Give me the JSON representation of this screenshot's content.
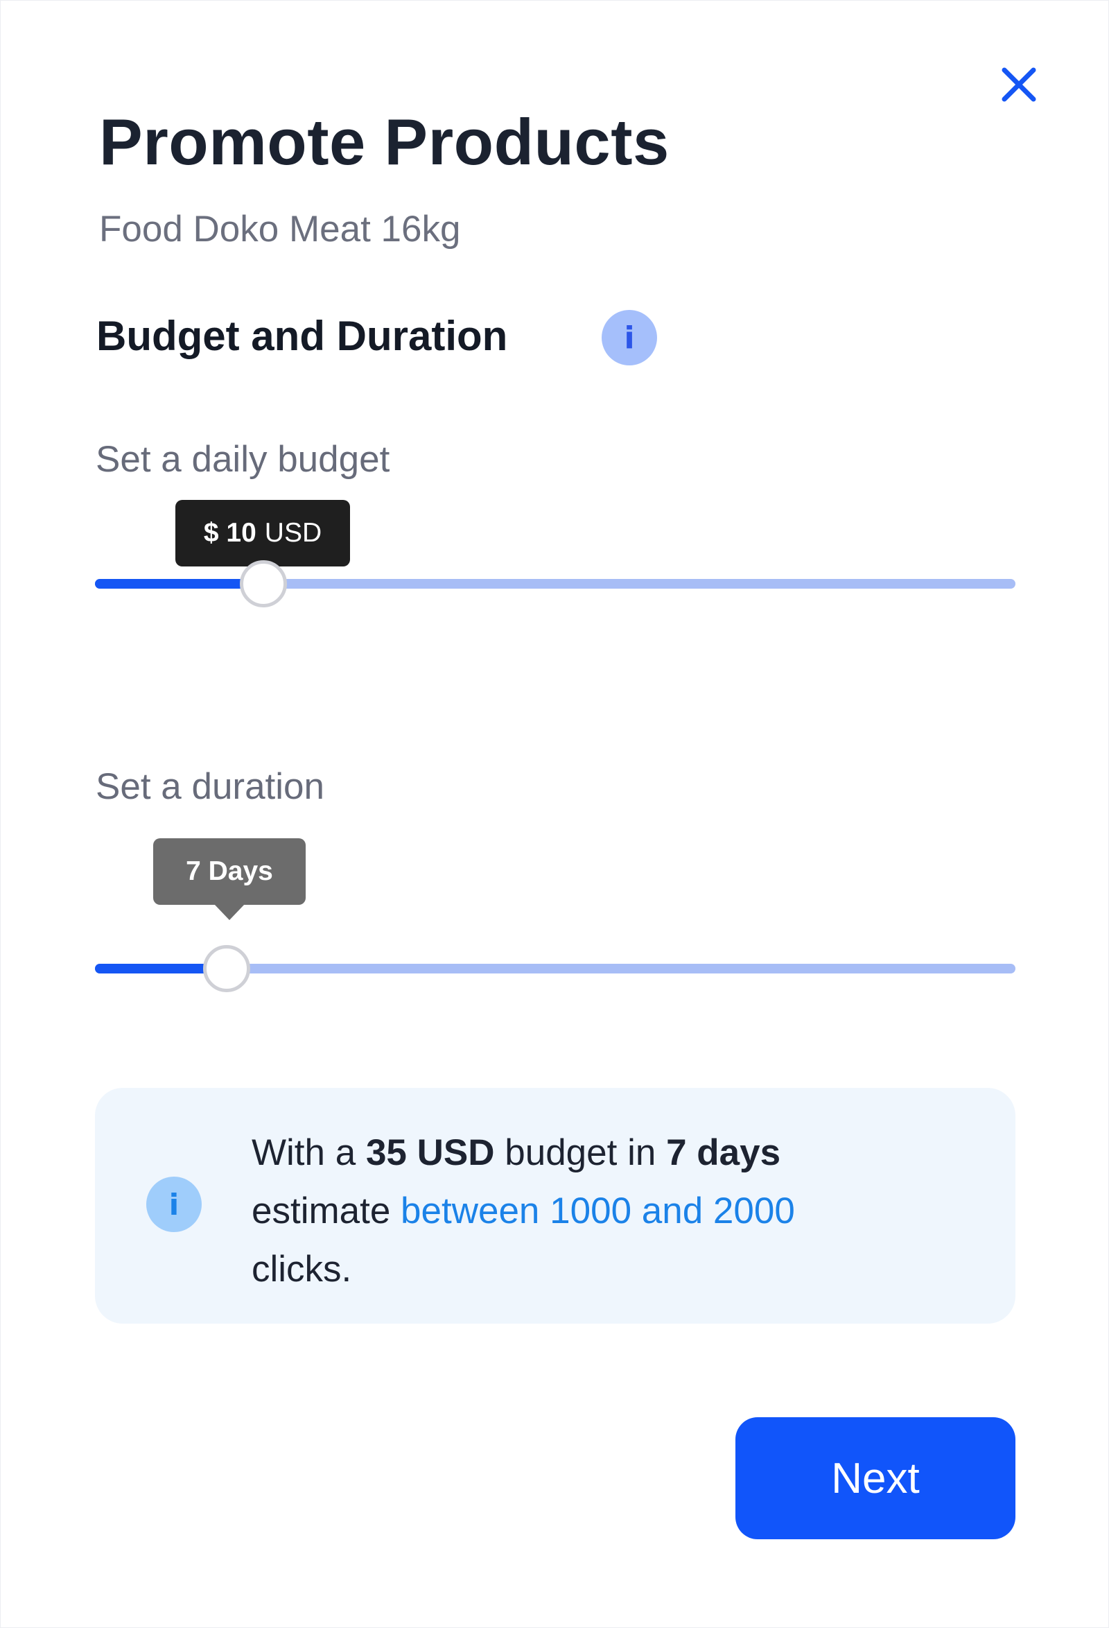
{
  "modal": {
    "title": "Promote Products",
    "product_name": "Food Doko Meat 16kg",
    "section_title": "Budget and Duration",
    "info_glyph": "i"
  },
  "budget": {
    "label": "Set a daily budget",
    "tooltip_value": "$ 10",
    "tooltip_unit": "USD",
    "slider_fraction": 0.183
  },
  "duration": {
    "label": "Set a duration",
    "tooltip": "7 Days",
    "slider_fraction": 0.143
  },
  "estimate": {
    "prefix": "With a ",
    "budget": "35 USD",
    "middle": " budget in ",
    "days": "7 days",
    "estimate_word": "estimate ",
    "range": "between 1000 and 2000",
    "suffix": "clicks."
  },
  "actions": {
    "next_label": "Next"
  },
  "colors": {
    "accent": "#1155fa",
    "slider_track": "#a7bdf6",
    "link": "#1b82e8",
    "estimate_background": "#eff6fd"
  },
  "icons": {
    "close": "close-icon",
    "section_info": "info-icon",
    "estimate_info": "info-icon"
  }
}
